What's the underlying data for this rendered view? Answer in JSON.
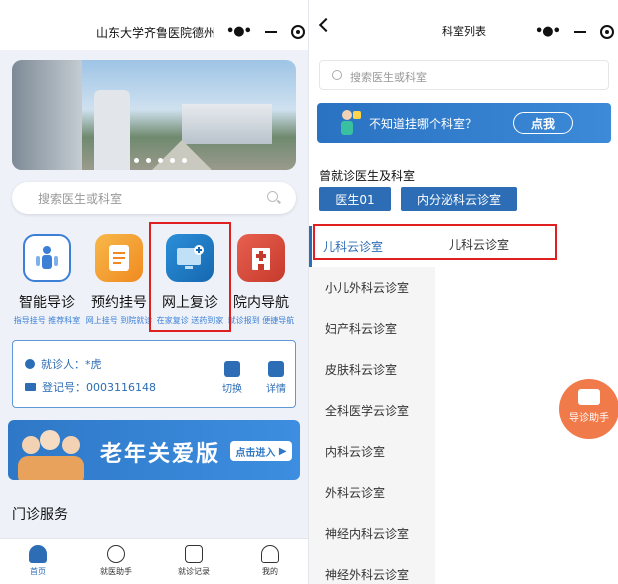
{
  "left": {
    "title": "山东大学齐鲁医院德州...",
    "search_placeholder": "搜索医生或科室",
    "services": [
      {
        "name": "智能导诊",
        "sub": "指导挂号 推荐科室",
        "color": "#3b7fd6"
      },
      {
        "name": "预约挂号",
        "sub": "网上挂号 到院就诊",
        "color": "#f0a030"
      },
      {
        "name": "网上复诊",
        "sub": "在家复诊 送药到家",
        "color": "#1f7fc9"
      },
      {
        "name": "院内导航",
        "sub": "就诊报到 便捷导航",
        "color": "#d94a3a"
      }
    ],
    "patient": {
      "name_label": "就诊人：*虎",
      "reg_label": "登记号：0003116148",
      "switch_label": "切换",
      "detail_label": "详情"
    },
    "elder_banner": {
      "text": "老年关爱版",
      "button": "点击进入"
    },
    "section_title": "门诊服务",
    "tabbar": [
      {
        "label": "首页",
        "icon": "home-icon",
        "active": true
      },
      {
        "label": "就医助手",
        "icon": "assistant-icon",
        "active": false
      },
      {
        "label": "就诊记录",
        "icon": "record-icon",
        "active": false
      },
      {
        "label": "我的",
        "icon": "profile-icon",
        "active": false
      }
    ]
  },
  "right": {
    "title": "科室列表",
    "search_placeholder": "搜索医生或科室",
    "unsure_banner": {
      "text": "不知道挂哪个科室？",
      "button": "点我"
    },
    "visited_title": "曾就诊医生及科室",
    "visited": [
      "医生01",
      "内分泌科云诊室"
    ],
    "departments": [
      "儿科云诊室",
      "小儿外科云诊室",
      "妇产科云诊室",
      "皮肤科云诊室",
      "全科医学云诊室",
      "内科云诊室",
      "外科云诊室",
      "神经内科云诊室",
      "神经外科云诊室"
    ],
    "selected_sub_department": "儿科云诊室",
    "float_button": "导诊助手"
  },
  "colors": {
    "primary": "#2c6db5",
    "highlight": "#e02020",
    "float": "#f07a4a"
  }
}
